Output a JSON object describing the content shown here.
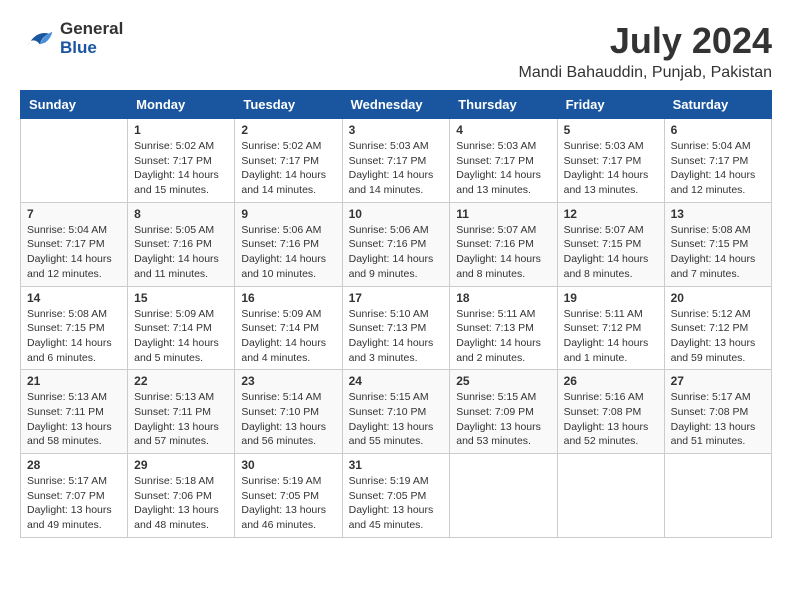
{
  "header": {
    "logo": {
      "general": "General",
      "blue": "Blue"
    },
    "title": "July 2024",
    "location": "Mandi Bahauddin, Punjab, Pakistan"
  },
  "calendar": {
    "days_of_week": [
      "Sunday",
      "Monday",
      "Tuesday",
      "Wednesday",
      "Thursday",
      "Friday",
      "Saturday"
    ],
    "weeks": [
      [
        {
          "day": "",
          "sunrise": "",
          "sunset": "",
          "daylight": ""
        },
        {
          "day": "1",
          "sunrise": "Sunrise: 5:02 AM",
          "sunset": "Sunset: 7:17 PM",
          "daylight": "Daylight: 14 hours and 15 minutes."
        },
        {
          "day": "2",
          "sunrise": "Sunrise: 5:02 AM",
          "sunset": "Sunset: 7:17 PM",
          "daylight": "Daylight: 14 hours and 14 minutes."
        },
        {
          "day": "3",
          "sunrise": "Sunrise: 5:03 AM",
          "sunset": "Sunset: 7:17 PM",
          "daylight": "Daylight: 14 hours and 14 minutes."
        },
        {
          "day": "4",
          "sunrise": "Sunrise: 5:03 AM",
          "sunset": "Sunset: 7:17 PM",
          "daylight": "Daylight: 14 hours and 13 minutes."
        },
        {
          "day": "5",
          "sunrise": "Sunrise: 5:03 AM",
          "sunset": "Sunset: 7:17 PM",
          "daylight": "Daylight: 14 hours and 13 minutes."
        },
        {
          "day": "6",
          "sunrise": "Sunrise: 5:04 AM",
          "sunset": "Sunset: 7:17 PM",
          "daylight": "Daylight: 14 hours and 12 minutes."
        }
      ],
      [
        {
          "day": "7",
          "sunrise": "Sunrise: 5:04 AM",
          "sunset": "Sunset: 7:17 PM",
          "daylight": "Daylight: 14 hours and 12 minutes."
        },
        {
          "day": "8",
          "sunrise": "Sunrise: 5:05 AM",
          "sunset": "Sunset: 7:16 PM",
          "daylight": "Daylight: 14 hours and 11 minutes."
        },
        {
          "day": "9",
          "sunrise": "Sunrise: 5:06 AM",
          "sunset": "Sunset: 7:16 PM",
          "daylight": "Daylight: 14 hours and 10 minutes."
        },
        {
          "day": "10",
          "sunrise": "Sunrise: 5:06 AM",
          "sunset": "Sunset: 7:16 PM",
          "daylight": "Daylight: 14 hours and 9 minutes."
        },
        {
          "day": "11",
          "sunrise": "Sunrise: 5:07 AM",
          "sunset": "Sunset: 7:16 PM",
          "daylight": "Daylight: 14 hours and 8 minutes."
        },
        {
          "day": "12",
          "sunrise": "Sunrise: 5:07 AM",
          "sunset": "Sunset: 7:15 PM",
          "daylight": "Daylight: 14 hours and 8 minutes."
        },
        {
          "day": "13",
          "sunrise": "Sunrise: 5:08 AM",
          "sunset": "Sunset: 7:15 PM",
          "daylight": "Daylight: 14 hours and 7 minutes."
        }
      ],
      [
        {
          "day": "14",
          "sunrise": "Sunrise: 5:08 AM",
          "sunset": "Sunset: 7:15 PM",
          "daylight": "Daylight: 14 hours and 6 minutes."
        },
        {
          "day": "15",
          "sunrise": "Sunrise: 5:09 AM",
          "sunset": "Sunset: 7:14 PM",
          "daylight": "Daylight: 14 hours and 5 minutes."
        },
        {
          "day": "16",
          "sunrise": "Sunrise: 5:09 AM",
          "sunset": "Sunset: 7:14 PM",
          "daylight": "Daylight: 14 hours and 4 minutes."
        },
        {
          "day": "17",
          "sunrise": "Sunrise: 5:10 AM",
          "sunset": "Sunset: 7:13 PM",
          "daylight": "Daylight: 14 hours and 3 minutes."
        },
        {
          "day": "18",
          "sunrise": "Sunrise: 5:11 AM",
          "sunset": "Sunset: 7:13 PM",
          "daylight": "Daylight: 14 hours and 2 minutes."
        },
        {
          "day": "19",
          "sunrise": "Sunrise: 5:11 AM",
          "sunset": "Sunset: 7:12 PM",
          "daylight": "Daylight: 14 hours and 1 minute."
        },
        {
          "day": "20",
          "sunrise": "Sunrise: 5:12 AM",
          "sunset": "Sunset: 7:12 PM",
          "daylight": "Daylight: 13 hours and 59 minutes."
        }
      ],
      [
        {
          "day": "21",
          "sunrise": "Sunrise: 5:13 AM",
          "sunset": "Sunset: 7:11 PM",
          "daylight": "Daylight: 13 hours and 58 minutes."
        },
        {
          "day": "22",
          "sunrise": "Sunrise: 5:13 AM",
          "sunset": "Sunset: 7:11 PM",
          "daylight": "Daylight: 13 hours and 57 minutes."
        },
        {
          "day": "23",
          "sunrise": "Sunrise: 5:14 AM",
          "sunset": "Sunset: 7:10 PM",
          "daylight": "Daylight: 13 hours and 56 minutes."
        },
        {
          "day": "24",
          "sunrise": "Sunrise: 5:15 AM",
          "sunset": "Sunset: 7:10 PM",
          "daylight": "Daylight: 13 hours and 55 minutes."
        },
        {
          "day": "25",
          "sunrise": "Sunrise: 5:15 AM",
          "sunset": "Sunset: 7:09 PM",
          "daylight": "Daylight: 13 hours and 53 minutes."
        },
        {
          "day": "26",
          "sunrise": "Sunrise: 5:16 AM",
          "sunset": "Sunset: 7:08 PM",
          "daylight": "Daylight: 13 hours and 52 minutes."
        },
        {
          "day": "27",
          "sunrise": "Sunrise: 5:17 AM",
          "sunset": "Sunset: 7:08 PM",
          "daylight": "Daylight: 13 hours and 51 minutes."
        }
      ],
      [
        {
          "day": "28",
          "sunrise": "Sunrise: 5:17 AM",
          "sunset": "Sunset: 7:07 PM",
          "daylight": "Daylight: 13 hours and 49 minutes."
        },
        {
          "day": "29",
          "sunrise": "Sunrise: 5:18 AM",
          "sunset": "Sunset: 7:06 PM",
          "daylight": "Daylight: 13 hours and 48 minutes."
        },
        {
          "day": "30",
          "sunrise": "Sunrise: 5:19 AM",
          "sunset": "Sunset: 7:05 PM",
          "daylight": "Daylight: 13 hours and 46 minutes."
        },
        {
          "day": "31",
          "sunrise": "Sunrise: 5:19 AM",
          "sunset": "Sunset: 7:05 PM",
          "daylight": "Daylight: 13 hours and 45 minutes."
        },
        {
          "day": "",
          "sunrise": "",
          "sunset": "",
          "daylight": ""
        },
        {
          "day": "",
          "sunrise": "",
          "sunset": "",
          "daylight": ""
        },
        {
          "day": "",
          "sunrise": "",
          "sunset": "",
          "daylight": ""
        }
      ]
    ]
  }
}
